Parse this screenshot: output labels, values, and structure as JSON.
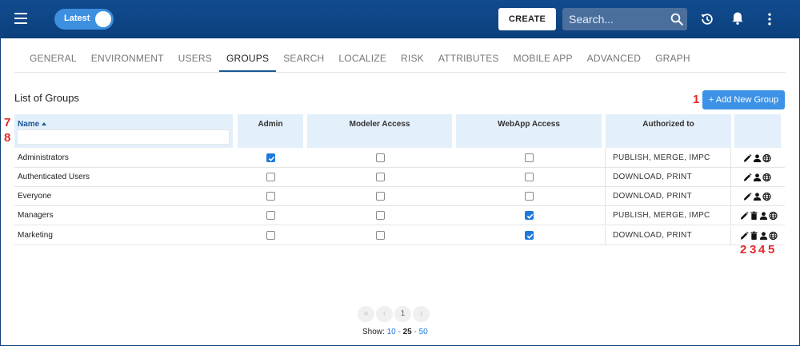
{
  "header": {
    "toggle_label": "Latest",
    "create_label": "CREATE",
    "search_placeholder": "Search..."
  },
  "tabs": [
    "GENERAL",
    "ENVIRONMENT",
    "USERS",
    "GROUPS",
    "SEARCH",
    "LOCALIZE",
    "RISK",
    "ATTRIBUTES",
    "MOBILE APP",
    "ADVANCED",
    "GRAPH"
  ],
  "active_tab": "GROUPS",
  "page": {
    "title": "List of Groups",
    "add_button": "+ Add New Group"
  },
  "markers": {
    "add": "1",
    "edit": "2",
    "delete": "3",
    "users": "4",
    "globe": "5",
    "name_header": "7",
    "filter": "8"
  },
  "table": {
    "headers": {
      "name": "Name",
      "admin": "Admin",
      "modeler": "Modeler Access",
      "webapp": "WebApp Access",
      "authorized": "Authorized to"
    },
    "rows": [
      {
        "name": "Administrators",
        "admin": true,
        "modeler": false,
        "webapp": false,
        "authorized": "PUBLISH, MERGE, IMPC",
        "actions": [
          "edit-icon",
          "user-icon",
          "globe-icon"
        ]
      },
      {
        "name": "Authenticated Users",
        "admin": false,
        "modeler": false,
        "webapp": false,
        "authorized": "DOWNLOAD, PRINT",
        "actions": [
          "edit-icon",
          "user-icon",
          "globe-icon"
        ]
      },
      {
        "name": "Everyone",
        "admin": false,
        "modeler": false,
        "webapp": false,
        "authorized": "DOWNLOAD, PRINT",
        "actions": [
          "edit-icon",
          "user-icon",
          "globe-icon"
        ]
      },
      {
        "name": "Managers",
        "admin": false,
        "modeler": false,
        "webapp": true,
        "authorized": "PUBLISH, MERGE, IMPC",
        "actions": [
          "edit-icon",
          "delete-icon",
          "user-icon",
          "globe-icon"
        ]
      },
      {
        "name": "Marketing",
        "admin": false,
        "modeler": false,
        "webapp": true,
        "authorized": "DOWNLOAD, PRINT",
        "actions": [
          "edit-icon",
          "delete-icon",
          "user-icon",
          "globe-icon"
        ]
      }
    ]
  },
  "pagination": {
    "first": "«",
    "prev": "‹",
    "current": "1",
    "next": "›",
    "show_label": "Show:",
    "sizes": [
      "10",
      "25",
      "50"
    ],
    "selected_size": "25"
  },
  "colors": {
    "header_bg": "#114c8f",
    "accent": "#3c92e6",
    "checkbox_on": "#1e79dc",
    "table_header_bg": "#e3effb",
    "marker": "#e02a2a"
  }
}
